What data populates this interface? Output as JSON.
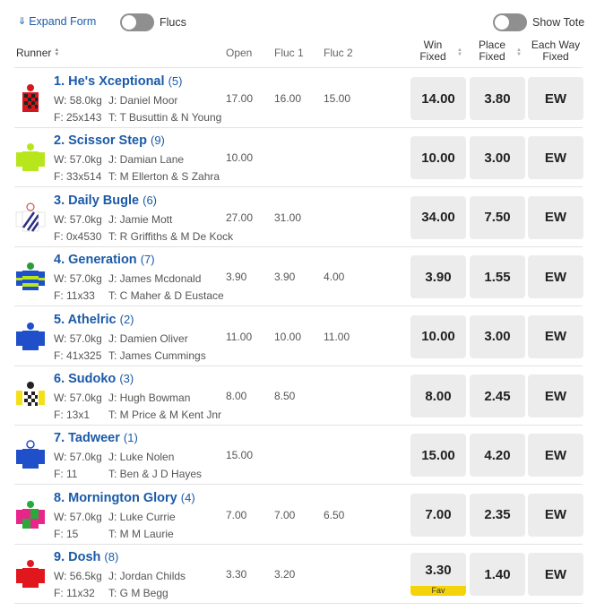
{
  "toolbar": {
    "expand_label": "Expand Form",
    "flucs_label": "Flucs",
    "tote_label": "Show Tote"
  },
  "header": {
    "runner": "Runner",
    "open": "Open",
    "fluc1": "Fluc 1",
    "fluc2": "Fluc 2",
    "win_fixed": "Win\nFixed",
    "place_fixed": "Place\nFixed",
    "each_way_fixed": "Each Way\nFixed"
  },
  "runners": [
    {
      "name": "1. He's Xceptional",
      "barrier": "(5)",
      "weight": "W: 58.0kg",
      "jockey": "J: Daniel Moor",
      "form": "F: 25x143",
      "trainer": "T: T Busuttin & N Young",
      "open": "17.00",
      "fluc1": "16.00",
      "fluc2": "15.00",
      "win": "14.00",
      "place": "3.80",
      "ew": "EW",
      "fav": "",
      "silk": "red-black-check"
    },
    {
      "name": "2. Scissor Step",
      "barrier": "(9)",
      "weight": "W: 57.0kg",
      "jockey": "J: Damian Lane",
      "form": "F: 33x514",
      "trainer": "T: M Ellerton & S Zahra",
      "open": "10.00",
      "fluc1": "",
      "fluc2": "",
      "win": "10.00",
      "place": "3.00",
      "ew": "EW",
      "fav": "",
      "silk": "lime"
    },
    {
      "name": "3. Daily Bugle",
      "barrier": "(6)",
      "weight": "W: 57.0kg",
      "jockey": "J: Jamie Mott",
      "form": "F: 0x4530",
      "trainer": "T: R Griffiths & M De Kock",
      "open": "27.00",
      "fluc1": "31.00",
      "fluc2": "",
      "win": "34.00",
      "place": "7.50",
      "ew": "EW",
      "fav": "",
      "silk": "white-navy-diagonal"
    },
    {
      "name": "4. Generation",
      "barrier": "(7)",
      "weight": "W: 57.0kg",
      "jockey": "J: James Mcdonald",
      "form": "F: 11x33",
      "trainer": "T: C Maher & D Eustace",
      "open": "3.90",
      "fluc1": "3.90",
      "fluc2": "4.00",
      "win": "3.90",
      "place": "1.55",
      "ew": "EW",
      "fav": "",
      "silk": "blue-lime-hoops"
    },
    {
      "name": "5. Athelric",
      "barrier": "(2)",
      "weight": "W: 57.0kg",
      "jockey": "J: Damien Oliver",
      "form": "F: 41x325",
      "trainer": "T: James Cummings",
      "open": "11.00",
      "fluc1": "10.00",
      "fluc2": "11.00",
      "win": "10.00",
      "place": "3.00",
      "ew": "EW",
      "fav": "",
      "silk": "royal-blue"
    },
    {
      "name": "6. Sudoko",
      "barrier": "(3)",
      "weight": "W: 57.0kg",
      "jockey": "J: Hugh Bowman",
      "form": "F: 13x1",
      "trainer": "T: M Price & M Kent Jnr",
      "open": "8.00",
      "fluc1": "8.50",
      "fluc2": "",
      "win": "8.00",
      "place": "2.45",
      "ew": "EW",
      "fav": "",
      "silk": "yellow-black-check"
    },
    {
      "name": "7. Tadweer",
      "barrier": "(1)",
      "weight": "W: 57.0kg",
      "jockey": "J: Luke Nolen",
      "form": "F: 11",
      "trainer": "T: Ben & J D Hayes",
      "open": "15.00",
      "fluc1": "",
      "fluc2": "",
      "win": "15.00",
      "place": "4.20",
      "ew": "EW",
      "fav": "",
      "silk": "blue-white-cap"
    },
    {
      "name": "8. Mornington Glory",
      "barrier": "(4)",
      "weight": "W: 57.0kg",
      "jockey": "J: Luke Currie",
      "form": "F: 15",
      "trainer": "T: M M Laurie",
      "open": "7.00",
      "fluc1": "7.00",
      "fluc2": "6.50",
      "win": "7.00",
      "place": "2.35",
      "ew": "EW",
      "fav": "",
      "silk": "pink-green-quarters"
    },
    {
      "name": "9. Dosh",
      "barrier": "(8)",
      "weight": "W: 56.5kg",
      "jockey": "J: Jordan Childs",
      "form": "F: 11x32",
      "trainer": "T: G M Begg",
      "open": "3.30",
      "fluc1": "3.20",
      "fluc2": "",
      "win": "3.30",
      "place": "1.40",
      "ew": "EW",
      "fav": "Fav",
      "silk": "red"
    }
  ],
  "colors": {
    "link": "#1a5aa8",
    "button_bg": "#ececec",
    "fav_badge": "#f5d30b",
    "toggle_off": "#8f8f8f"
  }
}
